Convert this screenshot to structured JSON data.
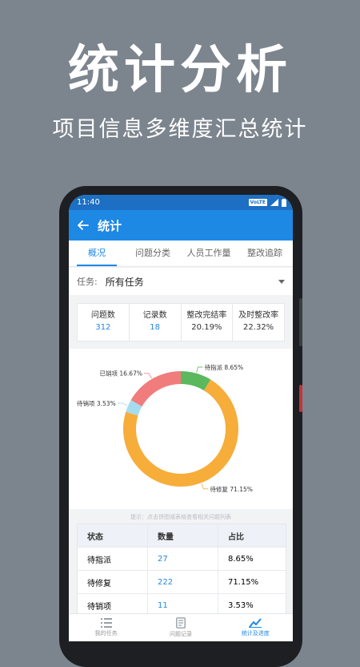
{
  "promo": {
    "title": "统计分析",
    "subtitle": "项目信息多维度汇总统计"
  },
  "statusbar": {
    "time": "11:40",
    "volte": "VoLTE"
  },
  "appbar": {
    "title": "统计"
  },
  "tabs": [
    {
      "label": "概况",
      "active": true
    },
    {
      "label": "问题分类",
      "active": false
    },
    {
      "label": "人员工作量",
      "active": false
    },
    {
      "label": "整改追踪",
      "active": false
    }
  ],
  "filter": {
    "label": "任务:",
    "value": "所有任务"
  },
  "stats": [
    {
      "header": "问题数",
      "value": "312"
    },
    {
      "header": "记录数",
      "value": "18"
    },
    {
      "header": "整改完结率",
      "value": "20.19%"
    },
    {
      "header": "及时整改率",
      "value": "22.32%"
    }
  ],
  "chart_data": {
    "type": "pie",
    "categories": [
      "待指派",
      "待修复",
      "待销项",
      "已销项"
    ],
    "values": [
      8.65,
      71.15,
      3.53,
      16.67
    ],
    "labels": [
      "待指派 8.65%",
      "待修复 71.15%",
      "待销项 3.53%",
      "已销项 16.67%"
    ],
    "colors": [
      "#5cb85c",
      "#f6ad3a",
      "#a6dcef",
      "#f17c7c"
    ]
  },
  "hint": "提示：点击饼图或表格查看相关问题列表",
  "table": {
    "headers": [
      "状态",
      "数量",
      "占比"
    ],
    "rows": [
      {
        "status": "待指派",
        "count": "27",
        "pct": "8.65%"
      },
      {
        "status": "待修复",
        "count": "222",
        "pct": "71.15%"
      },
      {
        "status": "待销项",
        "count": "11",
        "pct": "3.53%"
      }
    ]
  },
  "bottomnav": [
    {
      "label": "我的任务",
      "icon": "list-icon",
      "active": false
    },
    {
      "label": "问题记录",
      "icon": "document-icon",
      "active": false
    },
    {
      "label": "统计及进度",
      "icon": "trend-icon",
      "active": true
    }
  ]
}
